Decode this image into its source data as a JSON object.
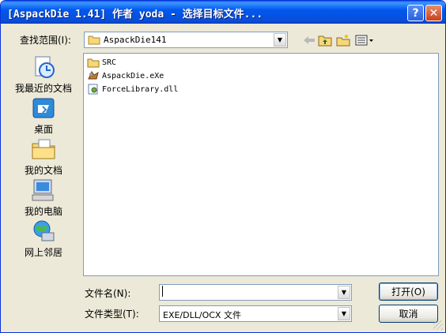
{
  "window": {
    "title": "[AspackDie 1.41] 作者 yoda - 选择目标文件...",
    "help_label": "?",
    "close_label": "✕"
  },
  "lookin": {
    "label": "查找范围(I):",
    "value": "AspackDie141"
  },
  "toolbar": {
    "back_icon": "back-arrow-icon",
    "up_icon": "up-folder-icon",
    "new_icon": "new-folder-icon",
    "view_icon": "view-menu-icon"
  },
  "places": [
    {
      "label": "我最近的文档",
      "icon": "recent-documents-icon"
    },
    {
      "label": "桌面",
      "icon": "desktop-icon"
    },
    {
      "label": "我的文档",
      "icon": "my-documents-icon"
    },
    {
      "label": "我的电脑",
      "icon": "my-computer-icon"
    },
    {
      "label": "网上邻居",
      "icon": "network-places-icon"
    }
  ],
  "files": [
    {
      "name": "SRC",
      "icon": "folder-icon"
    },
    {
      "name": "AspackDie.eXe",
      "icon": "exe-icon"
    },
    {
      "name": "ForceLibrary.dll",
      "icon": "dll-icon"
    }
  ],
  "filename": {
    "label": "文件名(N):",
    "value": ""
  },
  "filetype": {
    "label": "文件类型(T):",
    "value": "EXE/DLL/OCX 文件"
  },
  "buttons": {
    "open": "打开(O)",
    "cancel": "取消"
  },
  "colors": {
    "titlebar": "#0058ee",
    "dialog_bg": "#ece9d8",
    "field_border": "#7f9db9"
  }
}
